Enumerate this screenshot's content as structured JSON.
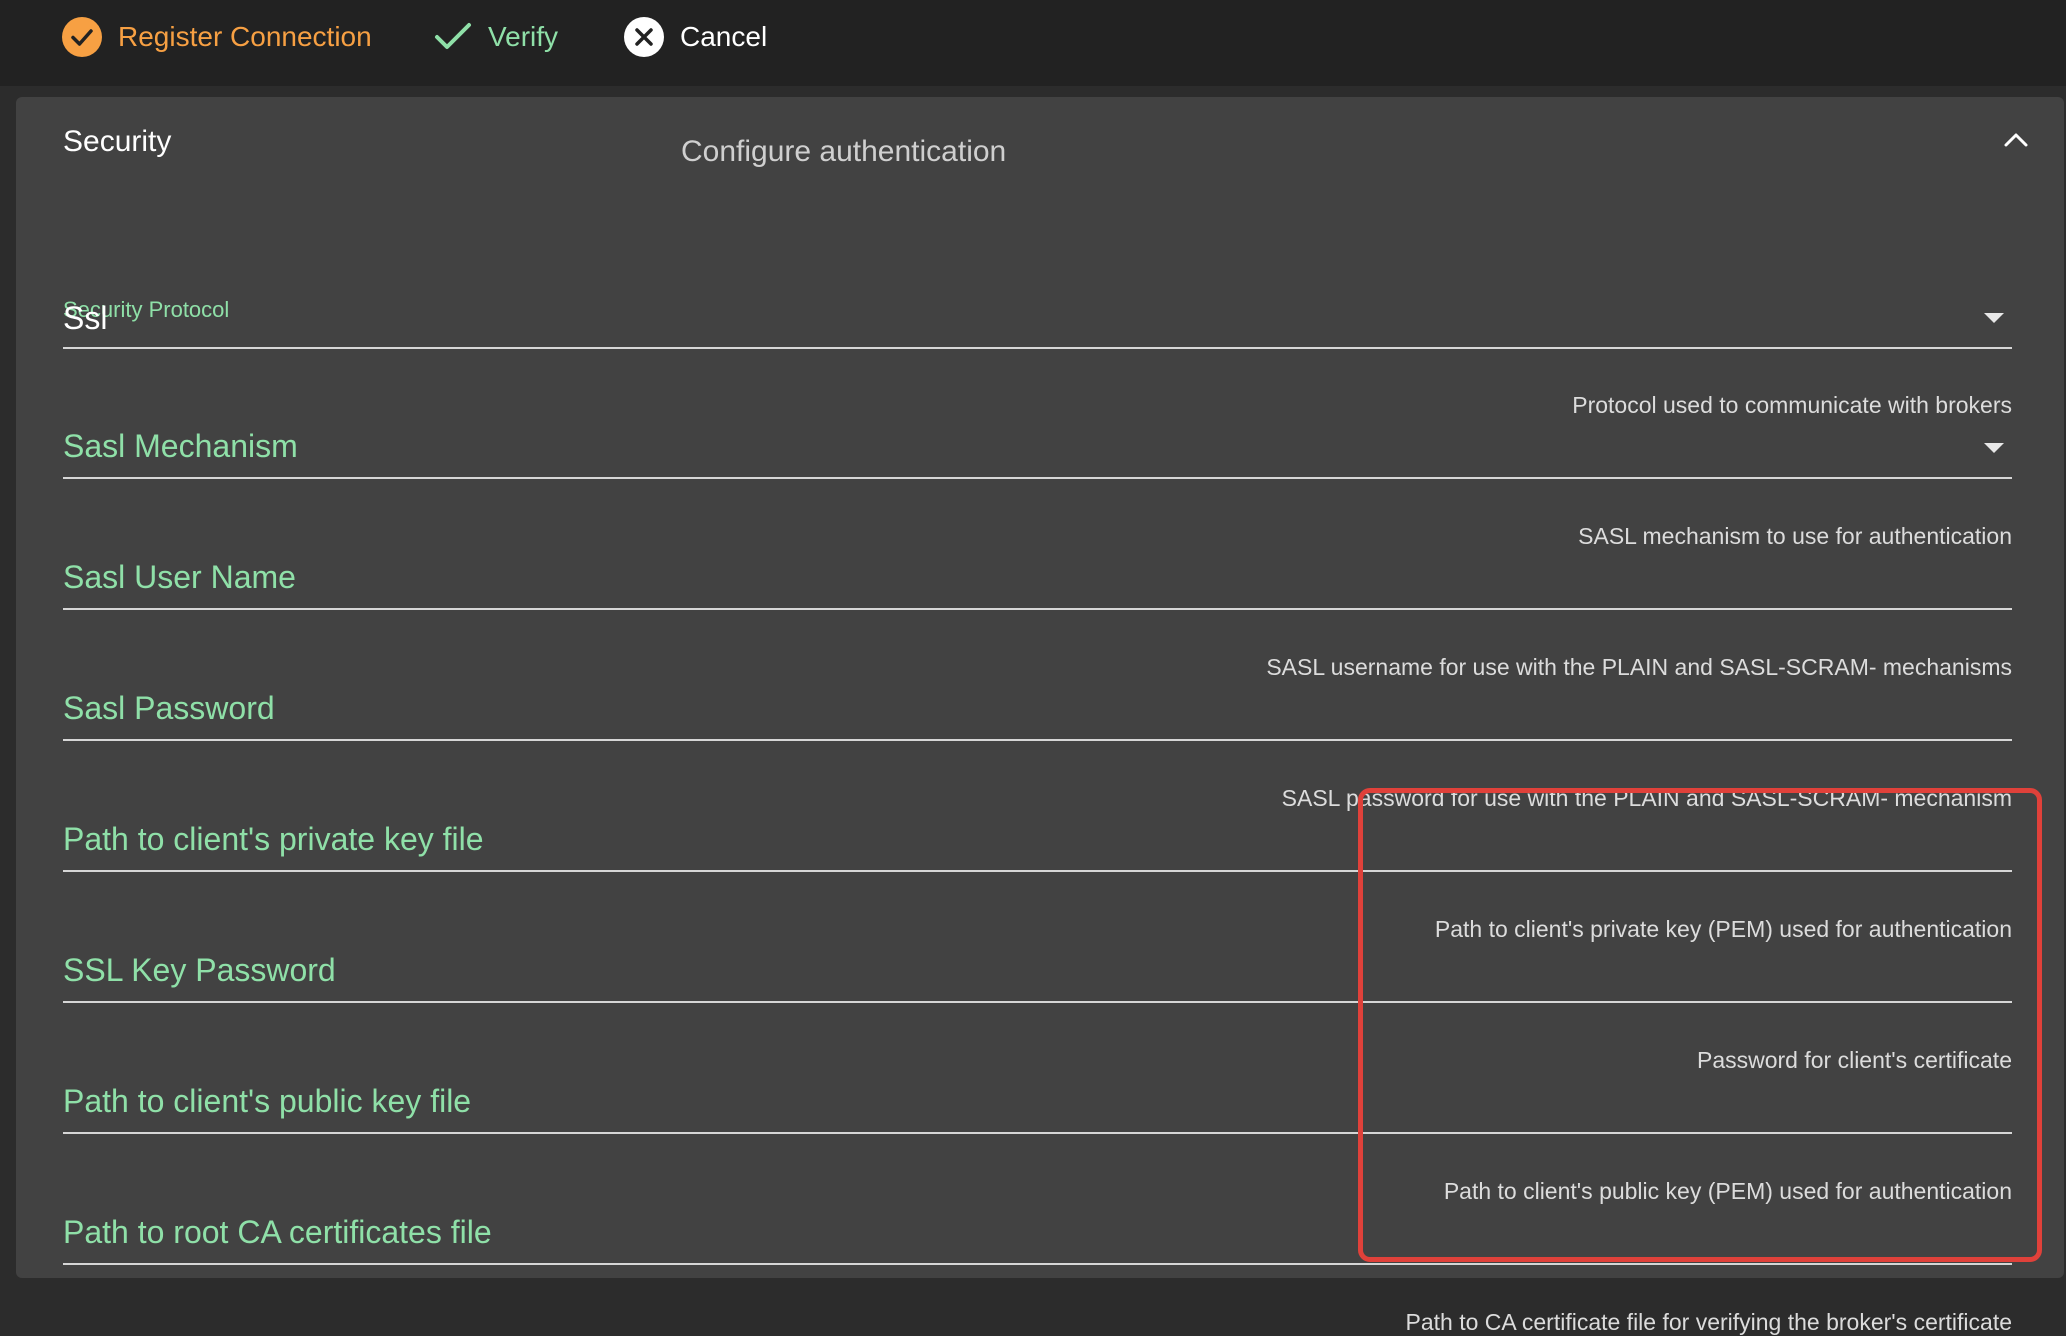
{
  "toolbar": {
    "register_label": "Register Connection",
    "verify_label": "Verify",
    "cancel_label": "Cancel"
  },
  "section": {
    "title": "Security",
    "subtitle": "Configure authentication"
  },
  "fields": {
    "security_protocol": {
      "label": "Security Protocol",
      "value": "Ssl",
      "hint": "Protocol used to communicate with brokers"
    },
    "sasl_mechanism": {
      "placeholder": "Sasl Mechanism",
      "hint": "SASL mechanism to use for authentication"
    },
    "sasl_user_name": {
      "placeholder": "Sasl User Name",
      "hint": "SASL username for use with the PLAIN and SASL-SCRAM- mechanisms"
    },
    "sasl_password": {
      "placeholder": "Sasl Password",
      "hint": "SASL password for use with the PLAIN and SASL-SCRAM- mechanism"
    },
    "private_key_path": {
      "placeholder": "Path to client's private key file",
      "hint": "Path to client's private key (PEM) used for authentication"
    },
    "ssl_key_password": {
      "placeholder": "SSL Key Password",
      "hint": "Password for client's certificate"
    },
    "public_key_path": {
      "placeholder": "Path to client's public key file",
      "hint": "Path to client's public key (PEM) used for authentication"
    },
    "ca_cert_path": {
      "placeholder": "Path to root CA certificates file",
      "hint": "Path to CA certificate file for verifying the broker's certificate"
    }
  },
  "icons": {
    "register": "check-circle-icon",
    "verify": "check-icon",
    "cancel": "close-circle-icon",
    "collapse": "chevron-up-icon",
    "dropdown": "caret-down-icon"
  },
  "colors": {
    "accent_orange": "#f7a043",
    "accent_green": "#8fe0a8",
    "annotation_red": "#e0413a"
  }
}
